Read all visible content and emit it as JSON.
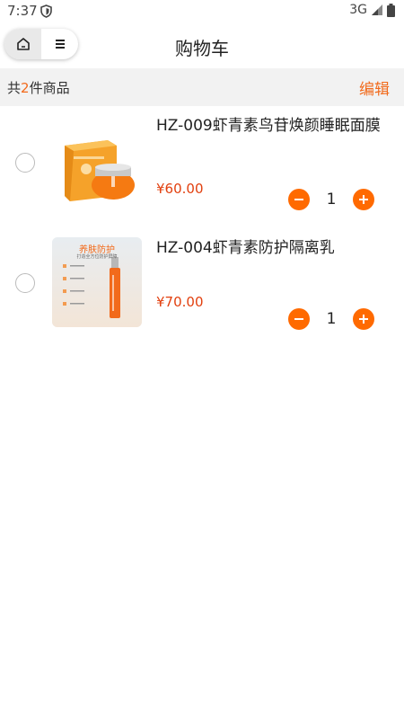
{
  "status": {
    "time": "7:37",
    "network": "3G"
  },
  "nav": {
    "title": "购物车"
  },
  "summary": {
    "prefix": "共",
    "count": "2",
    "suffix": "件商品",
    "edit_label": "编辑"
  },
  "items": [
    {
      "title": "HZ-009虾青素鸟苷焕颜睡眠面膜",
      "price": "¥60.00",
      "quantity": "1"
    },
    {
      "title": "HZ-004虾青素防护隔离乳",
      "price": "¥70.00",
      "quantity": "1",
      "image_text": {
        "headline": "养肤防护",
        "sub": "打造全方位防护屏障"
      }
    }
  ],
  "colors": {
    "accent": "#f26a1b",
    "price": "#e2400f",
    "qty_button": "#ff6a00"
  }
}
